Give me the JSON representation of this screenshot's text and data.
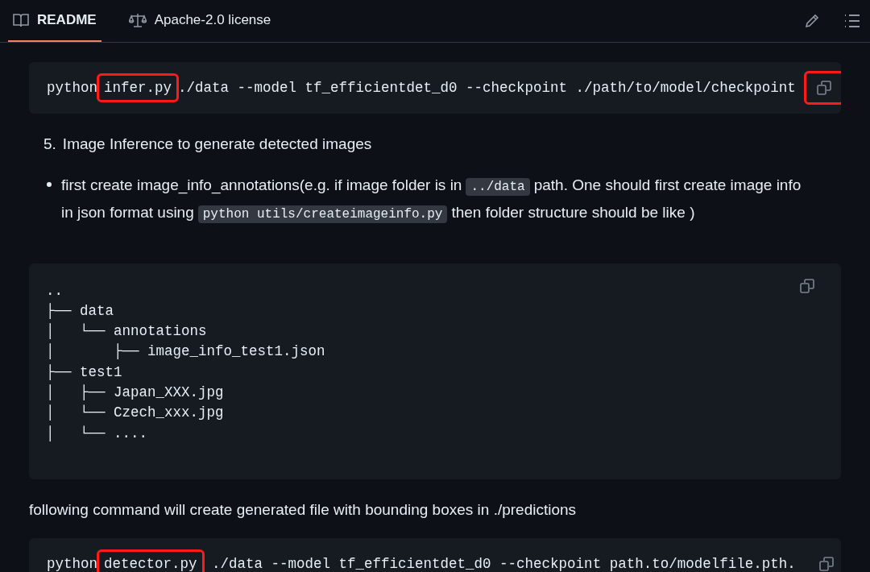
{
  "tabs": [
    {
      "label": "README",
      "selected": true
    },
    {
      "label": "Apache-2.0 license",
      "selected": false
    }
  ],
  "blocks": [
    {
      "kind": "command",
      "highlight_copy": true,
      "parts": [
        {
          "text": "python",
          "highlighted": false
        },
        {
          "text": "infer.py",
          "highlighted": true
        },
        {
          "text": "./data --model tf_efficientdet_d0 --checkpoint ./path/to/model/checkpoint",
          "highlighted": false
        }
      ]
    },
    {
      "kind": "numbered",
      "number": "5.",
      "text": "Image Inference to generate detected images"
    },
    {
      "kind": "bullet",
      "parts": [
        {
          "text": "first create image_info_annotations(e.g. if image folder is in",
          "code": false
        },
        {
          "text": "../data",
          "code": true
        },
        {
          "text": "path. One should first create image info in json format using",
          "code": false
        },
        {
          "text": "python utils/createimageinfo.py",
          "code": true
        },
        {
          "text": "then folder structure should be like )",
          "code": false
        }
      ]
    },
    {
      "kind": "tree",
      "lines": [
        "..",
        "├── data",
        "│   └── annotations",
        "│       ├── image_info_test1.json",
        "├── test1",
        "│   ├── Japan_XXX.jpg",
        "│   └── Czech_xxx.jpg",
        "│   └── ...."
      ]
    },
    {
      "kind": "paragraph",
      "text": "following command will create generated file with bounding boxes in ./predictions"
    },
    {
      "kind": "command",
      "highlight_copy": false,
      "parts": [
        {
          "text": "python",
          "highlighted": false
        },
        {
          "text": "detector.py",
          "highlighted": true
        },
        {
          "text": " ./data --model tf_efficientdet_d0 --checkpoint path.to/modelfile.pth.",
          "highlighted": false
        }
      ]
    }
  ]
}
